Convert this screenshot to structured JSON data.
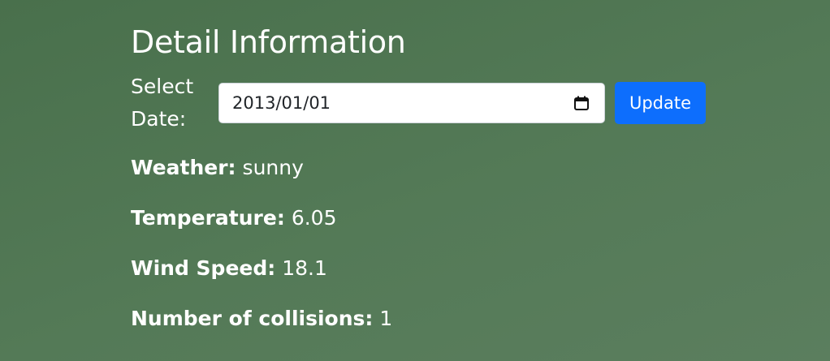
{
  "page": {
    "title": "Detail Information"
  },
  "date_picker": {
    "label": "Select Date:",
    "value": "2013/01/01",
    "update_label": "Update"
  },
  "details": [
    {
      "label": "Weather:",
      "value": "sunny"
    },
    {
      "label": "Temperature:",
      "value": "6.05"
    },
    {
      "label": "Wind Speed:",
      "value": "18.1"
    },
    {
      "label": "Number of collisions:",
      "value": "1"
    }
  ],
  "colors": {
    "background": "#527755",
    "button": "#0d6efd",
    "text": "#ffffff"
  },
  "icons": {
    "date_field": "calendar-icon"
  }
}
